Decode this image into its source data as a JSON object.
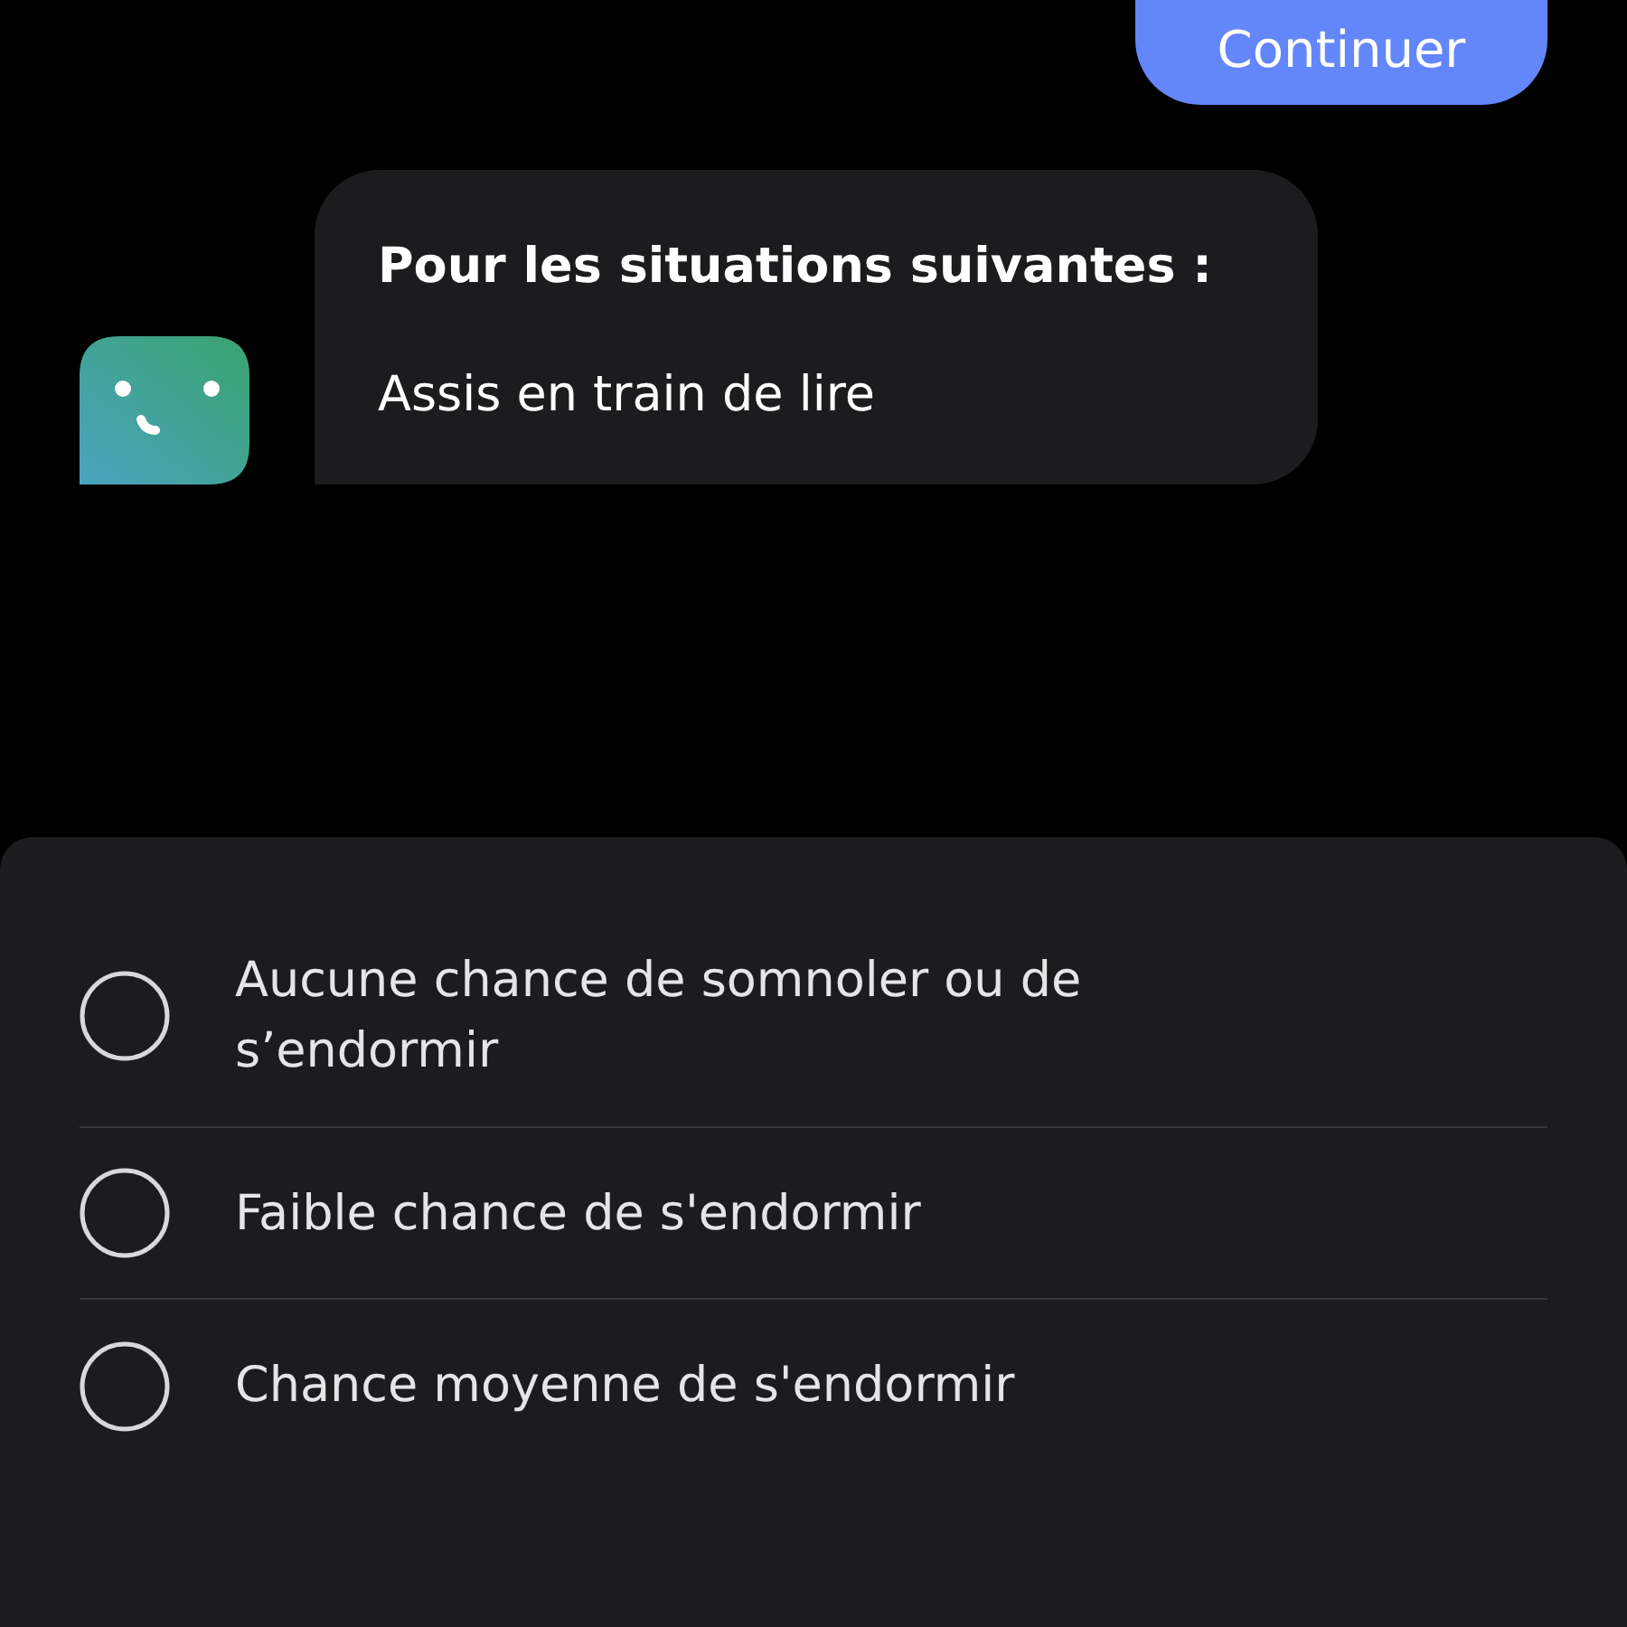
{
  "continue_button": {
    "label": "Continuer"
  },
  "bot_message": {
    "title": "Pour les situations suivantes :",
    "text": "Assis en train de lire"
  },
  "options": [
    {
      "label": "Aucune chance de somnoler ou de s’endormir",
      "selected": false
    },
    {
      "label": "Faible chance de s'endormir",
      "selected": false
    },
    {
      "label": "Chance moyenne de s'endormir",
      "selected": false
    }
  ]
}
